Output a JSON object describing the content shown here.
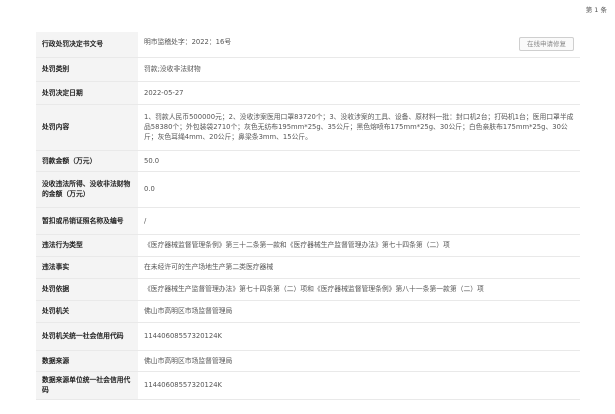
{
  "page_label": "第 1 条",
  "repair_button": "在线申请修复",
  "rows": [
    {
      "label": "行政处罚决定书文号",
      "value": "明市监稽处字：2022：16号"
    },
    {
      "label": "处罚类别",
      "value": "罚款;没收非法财物"
    },
    {
      "label": "处罚决定日期",
      "value": "2022-05-27"
    },
    {
      "label": "处罚内容",
      "value": "1、罚款人民币500000元；2、没收涉案医用口罩83720个；3、没收涉案的工具、设备、原材料一批：封口机2台；打码机1台；医用口罩半成品58380个；外包装袋2710个；灰色无纺布195mm*25g、35公斤；黑色熔喷布175mm*25g、30公斤；白色亲肤布175mm*25g、30公斤；灰色耳绳4mm、20公斤；鼻梁条3mm、15公斤。"
    },
    {
      "label": "罚款金额（万元）",
      "value": "50.0"
    },
    {
      "label": "没收违法所得、没收非法财物的金额（万元）",
      "value": "0.0"
    },
    {
      "label": "暂扣或吊销证照名称及编号",
      "value": "/"
    },
    {
      "label": "违法行为类型",
      "value": "《医疗器械监督管理条例》第三十二条第一款和《医疗器械生产监督管理办法》第七十四条第（二）项"
    },
    {
      "label": "违法事实",
      "value": "在未经许可的生产场地生产第二类医疗器械"
    },
    {
      "label": "处罚依据",
      "value": "《医疗器械生产监督管理办法》第七十四条第（二）项和《医疗器械监督管理条例》第八十一条第一款第（二）项"
    },
    {
      "label": "处罚机关",
      "value": "佛山市高明区市场监督管理局"
    },
    {
      "label": "处罚机关统一社会信用代码",
      "value": "11440608557320124K"
    },
    {
      "label": "数据来源",
      "value": "佛山市高明区市场监督管理局"
    },
    {
      "label": "数据来源单位统一社会信用代码",
      "value": "11440608557320124K"
    }
  ]
}
